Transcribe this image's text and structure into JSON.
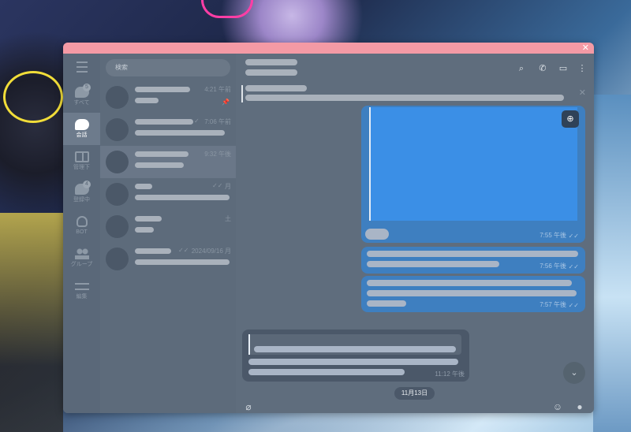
{
  "window": {
    "close_glyph": "✕"
  },
  "sidebar": {
    "menu_icon": "hamburger-menu-icon",
    "folders": [
      {
        "label": "すべて",
        "badge": "5",
        "icon": "chat-bubble-icon",
        "active": false
      },
      {
        "label": "会話",
        "badge": "",
        "icon": "chats-icon",
        "active": true
      },
      {
        "label": "管理下",
        "badge": "",
        "icon": "book-icon",
        "active": false
      },
      {
        "label": "登録中",
        "badge": "4",
        "icon": "channels-icon",
        "active": false
      },
      {
        "label": "BOT",
        "badge": "",
        "icon": "bot-icon",
        "active": false
      },
      {
        "label": "グループ",
        "badge": "",
        "icon": "group-icon",
        "active": false
      },
      {
        "label": "編集",
        "badge": "",
        "icon": "edit-folders-icon",
        "active": false
      }
    ]
  },
  "chat_list": {
    "search_placeholder": "検索",
    "items": [
      {
        "time": "4:21 午前",
        "pinned": true,
        "read": false
      },
      {
        "time": "7:06 午前",
        "pinned": false,
        "read": true
      },
      {
        "time": "9:32 午後",
        "pinned": false,
        "read": false
      },
      {
        "time": "月",
        "pinned": false,
        "read": true
      },
      {
        "time": "土",
        "pinned": false,
        "read": false
      },
      {
        "time": "2024/09/16 月",
        "pinned": false,
        "read": true
      }
    ]
  },
  "chat": {
    "header_icons": [
      "search-icon",
      "phone-icon",
      "sidebar-toggle-icon",
      "more-vertical-icon"
    ],
    "messages": [
      {
        "time": "7:55 午後",
        "read_glyph": "✓✓"
      },
      {
        "time": "7:56 午後",
        "read_glyph": "✓✓"
      },
      {
        "time": "7:57 午後",
        "read_glyph": "✓✓"
      },
      {
        "time": "11:12 午後"
      }
    ],
    "date_separator": "11月13日",
    "zoom_glyph": "⊕",
    "scroll_down_glyph": "⌄",
    "pinned_close_glyph": "✕"
  }
}
